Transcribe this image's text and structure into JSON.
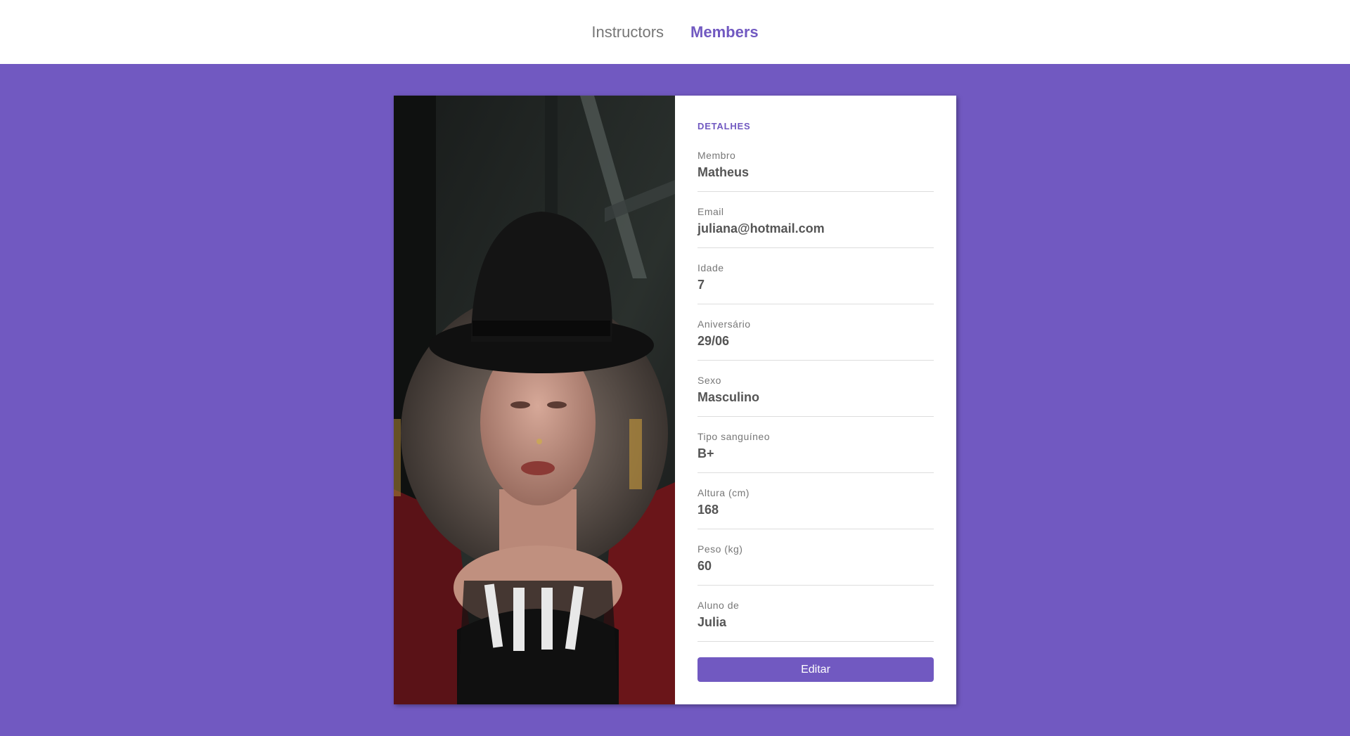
{
  "nav": {
    "items": [
      {
        "label": "Instructors",
        "active": false
      },
      {
        "label": "Members",
        "active": true
      }
    ]
  },
  "details": {
    "title": "DETALHES",
    "fields": [
      {
        "label": "Membro",
        "value": "Matheus"
      },
      {
        "label": "Email",
        "value": "juliana@hotmail.com"
      },
      {
        "label": "Idade",
        "value": "7"
      },
      {
        "label": "Aniversário",
        "value": "29/06"
      },
      {
        "label": "Sexo",
        "value": "Masculino"
      },
      {
        "label": "Tipo sanguíneo",
        "value": "B+"
      },
      {
        "label": "Altura (cm)",
        "value": "168"
      },
      {
        "label": "Peso (kg)",
        "value": "60"
      },
      {
        "label": "Aluno de",
        "value": "Julia"
      }
    ],
    "edit_label": "Editar"
  },
  "colors": {
    "primary": "#7159c1",
    "header_bg": "#ffffff",
    "card_bg": "#ffffff",
    "label": "#777777",
    "value": "#555555"
  }
}
